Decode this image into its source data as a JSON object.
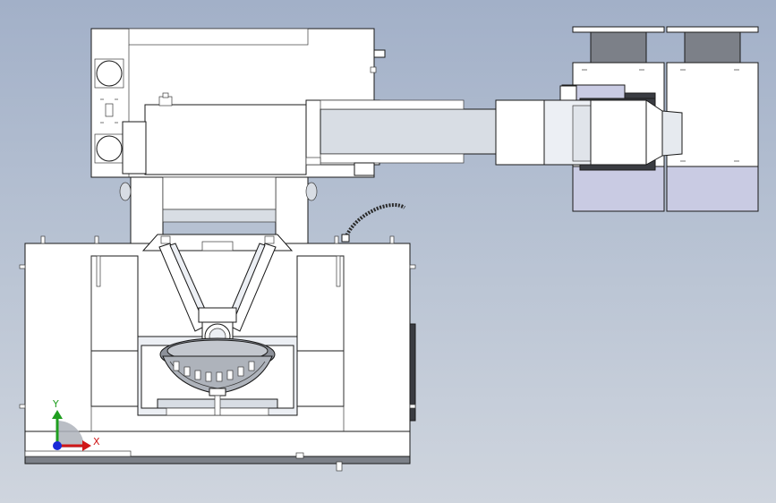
{
  "triad": {
    "y_label": "Y",
    "x_label": "X",
    "y_color": "#1f9e1f",
    "x_color": "#d01818",
    "origin_color": "#1a2ad8"
  },
  "colors": {
    "background_top": "#a2b0c8",
    "background_bottom": "#cfd5de",
    "part_face": "#ffffff",
    "shaded_face": "#d8dde4",
    "lavender_face": "#c9cbe3",
    "grey_plate": "#7c8088",
    "outline": "#1a1a1a"
  }
}
